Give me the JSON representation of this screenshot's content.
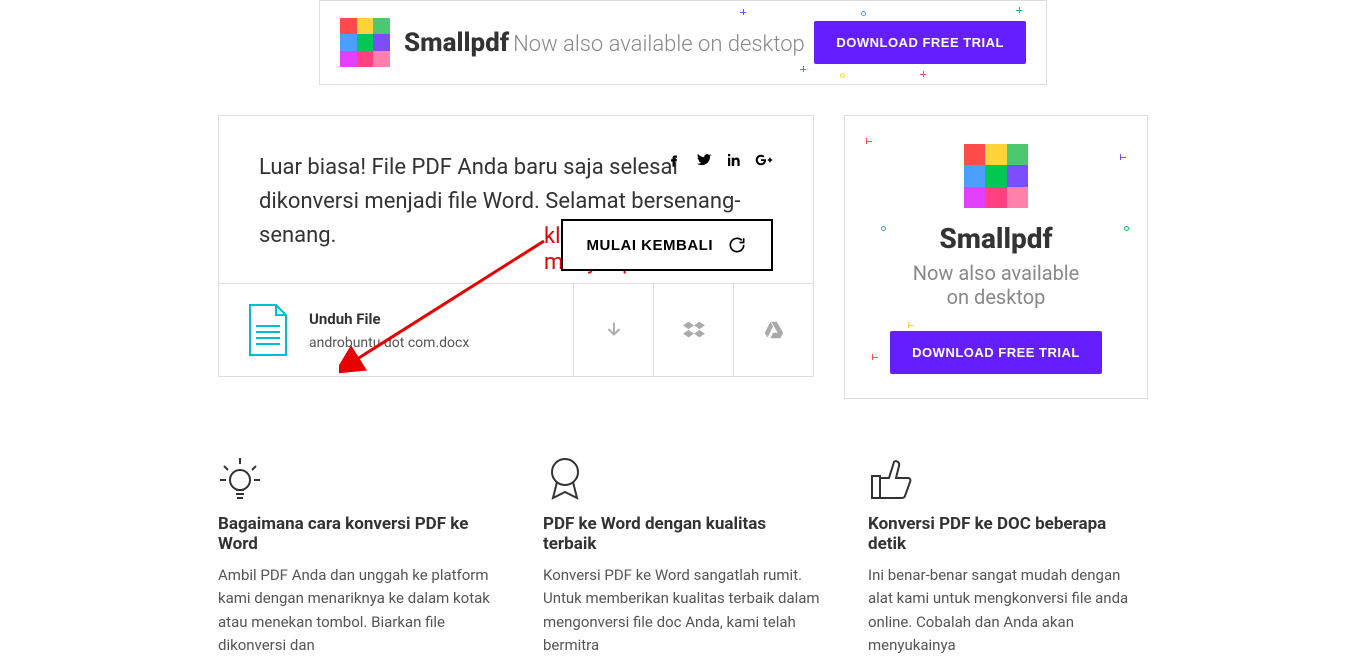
{
  "banner": {
    "brand": "Smallpdf",
    "tagline": "Now also available on desktop",
    "cta": "DOWNLOAD FREE TRIAL"
  },
  "result": {
    "message": "Luar biasa! File PDF Anda baru saja selesai dikonversi menjadi file Word. Selamat bersenang-senang.",
    "restart": "MULAI KEMBALI",
    "download_label": "Unduh File",
    "filename": "androbuntu dot com.docx"
  },
  "annotation": {
    "line1": "klik untuk",
    "line2": "menyimpan file"
  },
  "sidebar": {
    "brand": "Smallpdf",
    "line1": "Now also available",
    "line2": "on desktop",
    "cta": "DOWNLOAD FREE TRIAL"
  },
  "features": [
    {
      "title": "Bagaimana cara konversi PDF ke Word",
      "text": "Ambil PDF Anda dan unggah ke platform kami dengan menariknya ke dalam kotak atau menekan tombol. Biarkan file dikonversi dan"
    },
    {
      "title": "PDF ke Word dengan kualitas terbaik",
      "text": "Konversi PDF ke Word sangatlah rumit. Untuk memberikan kualitas terbaik dalam mengonversi file doc Anda, kami telah bermitra"
    },
    {
      "title": "Konversi PDF ke DOC beberapa detik",
      "text": "Ini benar-benar sangat mudah dengan alat kami untuk mengkonversi file anda online. Cobalah dan Anda akan menyukainya"
    }
  ]
}
